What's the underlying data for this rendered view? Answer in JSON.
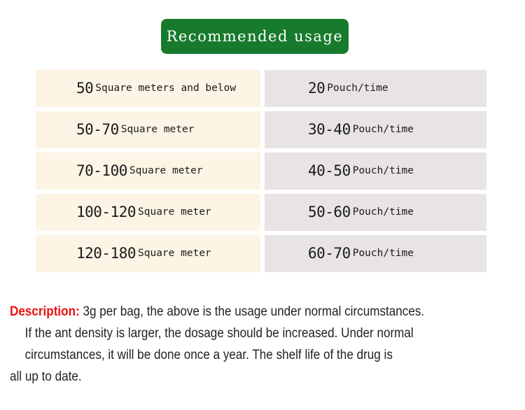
{
  "banner": {
    "title": "Recommended usage",
    "background_color": "#177A2C",
    "text_color": "#FFFFFF"
  },
  "table": {
    "area_cell_color": "#FCF4E4",
    "dose_cell_color": "#E7E4E3",
    "rows": [
      {
        "area_value": "50",
        "area_unit": "Square meters and below",
        "dose_value": "20",
        "dose_unit": "Pouch/time"
      },
      {
        "area_value": "50-70",
        "area_unit": "Square meter",
        "dose_value": "30-40",
        "dose_unit": "Pouch/time"
      },
      {
        "area_value": "70-100",
        "area_unit": "Square meter",
        "dose_value": "40-50",
        "dose_unit": "Pouch/time"
      },
      {
        "area_value": "100-120",
        "area_unit": "Square meter",
        "dose_value": "50-60",
        "dose_unit": "Pouch/time"
      },
      {
        "area_value": "120-180",
        "area_unit": "Square meter",
        "dose_value": "60-70",
        "dose_unit": "Pouch/time"
      }
    ]
  },
  "description": {
    "label": "Description:",
    "label_color": "#ED1111",
    "line1": "3g per bag, the above is the usage under normal circumstances.",
    "line2": "If the ant density is larger, the dosage should be increased. Under normal",
    "line3": "circumstances, it will be done once a year. The shelf life of the drug is",
    "line4": "all up to date."
  }
}
